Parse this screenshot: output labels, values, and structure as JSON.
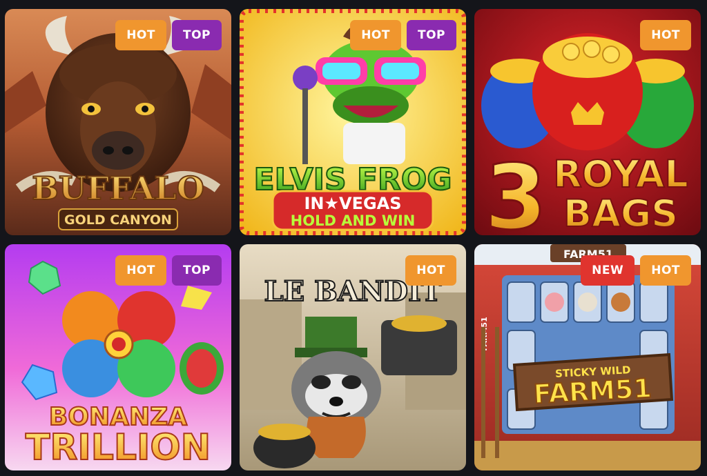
{
  "colors": {
    "hot": "#f0962e",
    "top": "#8a2bb0",
    "new": "#e0342e",
    "page_bg": "#14151a"
  },
  "games": [
    {
      "title_line1": "BUFFALO",
      "title_line2": "GOLD CANYON",
      "badges": [
        {
          "label": "HOT",
          "kind": "hot"
        },
        {
          "label": "TOP",
          "kind": "top"
        }
      ]
    },
    {
      "title_line1": "ELVIS FROG",
      "title_line2": "IN★VEGAS",
      "title_line3": "HOLD AND WIN",
      "badges": [
        {
          "label": "HOT",
          "kind": "hot"
        },
        {
          "label": "TOP",
          "kind": "top"
        }
      ]
    },
    {
      "title_number": "3",
      "title_line1": "ROYAL",
      "title_line2": "BAGS",
      "badges": [
        {
          "label": "HOT",
          "kind": "hot"
        }
      ]
    },
    {
      "title_line1": "BONANZA",
      "title_line2": "TRILLION",
      "badges": [
        {
          "label": "HOT",
          "kind": "hot"
        },
        {
          "label": "TOP",
          "kind": "top"
        }
      ]
    },
    {
      "title_line1": "LE BANDIT",
      "badges": [
        {
          "label": "HOT",
          "kind": "hot"
        }
      ]
    },
    {
      "title_top": "FARM51",
      "title_side": "FARM51",
      "title_line1": "STICKY WILD",
      "title_line2": "FARM51",
      "badges": [
        {
          "label": "NEW",
          "kind": "new"
        },
        {
          "label": "HOT",
          "kind": "hot"
        }
      ]
    }
  ]
}
